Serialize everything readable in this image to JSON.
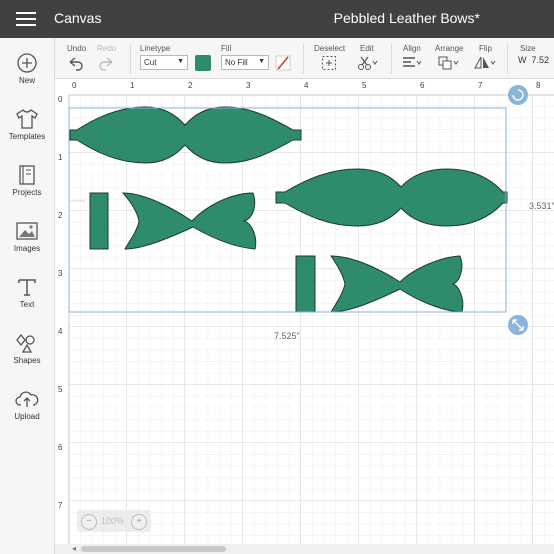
{
  "header": {
    "app_title": "Canvas",
    "doc_title": "Pebbled Leather Bows*"
  },
  "toolbar": {
    "undo_label": "Undo",
    "redo_label": "Redo",
    "linetype_label": "Linetype",
    "linetype_value": "Cut",
    "fill_label": "Fill",
    "fill_value": "No Fill",
    "fill_color": "#2e8b6b",
    "deselect_label": "Deselect",
    "edit_label": "Edit",
    "align_label": "Align",
    "arrange_label": "Arrange",
    "flip_label": "Flip",
    "size_label": "Size",
    "size_w_prefix": "W",
    "size_w_value": "7.52"
  },
  "sidebar": {
    "items": [
      {
        "label": "New",
        "icon": "plus-circle-icon"
      },
      {
        "label": "Templates",
        "icon": "tshirt-icon"
      },
      {
        "label": "Projects",
        "icon": "book-icon"
      },
      {
        "label": "Images",
        "icon": "image-icon"
      },
      {
        "label": "Text",
        "icon": "text-t-icon"
      },
      {
        "label": "Shapes",
        "icon": "shapes-icon"
      },
      {
        "label": "Upload",
        "icon": "cloud-upload-icon"
      }
    ]
  },
  "canvas": {
    "ruler_top": [
      "0",
      "1",
      "2",
      "3",
      "4",
      "5",
      "6",
      "7",
      "8"
    ],
    "ruler_left": [
      "0",
      "1",
      "2",
      "3",
      "4",
      "5",
      "6",
      "7"
    ],
    "width_label": "7.525\"",
    "height_label": "3.531\"",
    "shape_color": "#2e8b6b",
    "selection_color": "#8ab4d8"
  },
  "zoom": {
    "minus": "−",
    "value": "100%",
    "plus": "+"
  },
  "colors": {
    "topbar": "#414142",
    "toolbar": "#f6f6f6",
    "grid_minor": "#ececec",
    "grid_major": "#d2d2d2"
  }
}
